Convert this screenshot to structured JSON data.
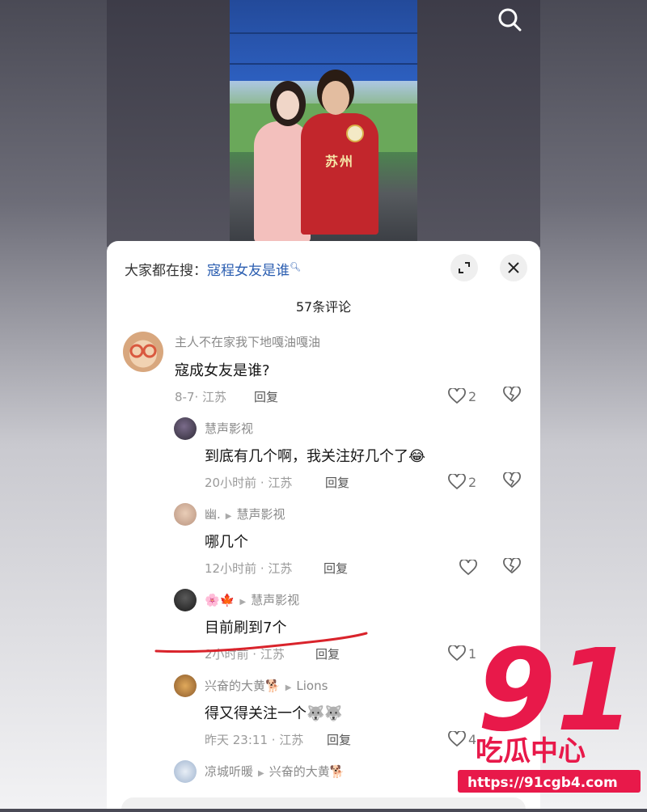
{
  "hot_search": {
    "prefix": "大家都在搜：",
    "term": "寇程女友是谁"
  },
  "comment_count": "57条评论",
  "reply_label": "回复",
  "comments": [
    {
      "user": "主人不在家我下地嘎油嘎油",
      "text": "寇成女友是谁?",
      "meta": "8-7· 江苏",
      "likes": "2"
    },
    {
      "user": "慧声影视",
      "text": "到底有几个啊，我关注好几个了",
      "meta": "20小时前 · 江苏",
      "likes": "2"
    },
    {
      "user": "幽.",
      "reply_to": "慧声影视",
      "text": "哪几个",
      "meta": "12小时前 · 江苏",
      "likes": ""
    },
    {
      "user": "🌸🍁",
      "reply_to": "慧声影视",
      "text": "目前刷到7个",
      "meta": "2小时前 · 江苏",
      "likes": "1"
    },
    {
      "user": "兴奋的大黄🐕",
      "reply_to": "Lions",
      "text": "得又得关注一个",
      "meta": "昨天 23:11 · 江苏",
      "likes": "4"
    },
    {
      "user": "凉城听暖",
      "reply_to": "兴奋的大黄🐕",
      "text": "",
      "meta": "",
      "likes": ""
    }
  ],
  "jersey_text": "苏州",
  "watermark": {
    "number": "91",
    "name": "吃瓜中心",
    "url": "https://91cgb4.com"
  },
  "colors": {
    "link": "#2a5db0",
    "annotation": "#d9232b",
    "watermark": "#e8194a"
  }
}
